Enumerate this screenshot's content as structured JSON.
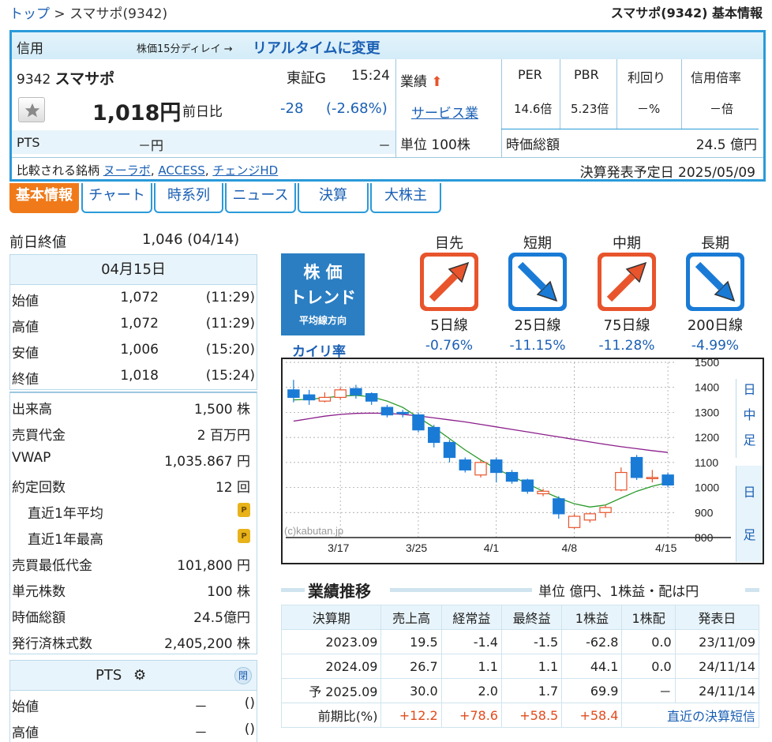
{
  "breadcrumb": {
    "top": "トップ",
    "sep": ">",
    "current": "スマサポ(9342)"
  },
  "page_title": "スマサポ(9342) 基本情報",
  "header": {
    "kind": "信用",
    "delay": "株価15分ディレイ →",
    "realtime": "リアルタイムに変更",
    "code": "9342",
    "name": "スマサポ",
    "market": "東証G",
    "time": "15:24",
    "price": "1,018円",
    "change_label": "前日比",
    "change": "-28",
    "change_pct": "(-2.68%)",
    "pts_label": "PTS",
    "pts_value": "－円",
    "pts_change": "－",
    "gyoseki": "業績",
    "industry": "サービス業",
    "unit": "単位 100株",
    "per_label": "PER",
    "per": "14.6倍",
    "pbr_label": "PBR",
    "pbr": "5.23倍",
    "yield_label": "利回り",
    "yield": "－%",
    "margin_label": "信用倍率",
    "margin": "－倍",
    "mcap_label": "時価総額",
    "mcap": "24.5 億円",
    "compare_label": "比較される銘柄",
    "compare": [
      "ヌーラボ",
      "ACCESS",
      "チェンジHD"
    ],
    "earnings_label": "決算発表予定日",
    "earnings_date": "2025/05/09"
  },
  "tabs": [
    "基本情報",
    "チャート",
    "時系列",
    "ニュース",
    "決算",
    "大株主"
  ],
  "prev_close": {
    "label": "前日終値",
    "value": "1,046 (04/14)"
  },
  "date_head": "04月15日",
  "ohlc": [
    {
      "k": "始値",
      "v": "1,072",
      "t": "(11:29)"
    },
    {
      "k": "高値",
      "v": "1,072",
      "t": "(11:29)"
    },
    {
      "k": "安値",
      "v": "1,006",
      "t": "(15:20)"
    },
    {
      "k": "終値",
      "v": "1,018",
      "t": "(15:24)"
    }
  ],
  "stats": [
    {
      "k": "出来高",
      "v": "1,500 株"
    },
    {
      "k": "売買代金",
      "v": "2 百万円"
    },
    {
      "k": "VWAP",
      "v": "1,035.867 円"
    },
    {
      "k": "約定回数",
      "v": "12 回"
    },
    {
      "k": "直近1年平均",
      "v": ""
    },
    {
      "k": "直近1年最高",
      "v": ""
    },
    {
      "k": "売買最低代金",
      "v": "101,800 円"
    },
    {
      "k": "単元株数",
      "v": "100 株"
    },
    {
      "k": "時価総額",
      "v": "24.5億円"
    },
    {
      "k": "発行済株式数",
      "v": "2,405,200 株"
    }
  ],
  "pts": {
    "title": "PTS",
    "close_btn": "閉",
    "rows": [
      {
        "k": "始値",
        "v": "－",
        "t": "()"
      },
      {
        "k": "高値",
        "v": "－",
        "t": "()"
      }
    ]
  },
  "trend": {
    "box": [
      "株 価",
      "トレンド",
      "平均線方向"
    ],
    "kairi": "カイリ率",
    "items": [
      {
        "term": "目先",
        "line": "5日線",
        "rate": "-0.76%",
        "dir": "up"
      },
      {
        "term": "短期",
        "line": "25日線",
        "rate": "-11.15%",
        "dir": "down"
      },
      {
        "term": "中期",
        "line": "75日線",
        "rate": "-11.28%",
        "dir": "up"
      },
      {
        "term": "長期",
        "line": "200日線",
        "rate": "-4.99%",
        "dir": "down"
      }
    ]
  },
  "period_side": {
    "chars1": [
      "日",
      "中",
      "足"
    ],
    "chars2": [
      "日",
      "足"
    ]
  },
  "chart_data": {
    "type": "candlestick",
    "watermark": "(c)kabutan.jp",
    "x_ticks": [
      "3/17",
      "3/25",
      "4/1",
      "4/8",
      "4/15"
    ],
    "y_ticks": [
      1500,
      1400,
      1300,
      1200,
      1100,
      1000,
      900,
      800
    ],
    "ylim": [
      800,
      1500
    ],
    "candles": [
      {
        "o": 1390,
        "c": 1360,
        "h": 1430,
        "l": 1340
      },
      {
        "o": 1370,
        "c": 1350,
        "h": 1390,
        "l": 1330
      },
      {
        "o": 1345,
        "c": 1360,
        "h": 1380,
        "l": 1340
      },
      {
        "o": 1360,
        "c": 1390,
        "h": 1400,
        "l": 1350
      },
      {
        "o": 1395,
        "c": 1370,
        "h": 1410,
        "l": 1355
      },
      {
        "o": 1375,
        "c": 1345,
        "h": 1380,
        "l": 1330
      },
      {
        "o": 1320,
        "c": 1290,
        "h": 1330,
        "l": 1280
      },
      {
        "o": 1300,
        "c": 1295,
        "h": 1310,
        "l": 1280
      },
      {
        "o": 1290,
        "c": 1230,
        "h": 1300,
        "l": 1220
      },
      {
        "o": 1240,
        "c": 1180,
        "h": 1250,
        "l": 1160
      },
      {
        "o": 1180,
        "c": 1120,
        "h": 1190,
        "l": 1100
      },
      {
        "o": 1110,
        "c": 1070,
        "h": 1120,
        "l": 1060
      },
      {
        "o": 1050,
        "c": 1100,
        "h": 1110,
        "l": 1040
      },
      {
        "o": 1110,
        "c": 1060,
        "h": 1120,
        "l": 1020
      },
      {
        "o": 1060,
        "c": 1025,
        "h": 1070,
        "l": 1015
      },
      {
        "o": 1030,
        "c": 985,
        "h": 1035,
        "l": 975
      },
      {
        "o": 975,
        "c": 985,
        "h": 995,
        "l": 965
      },
      {
        "o": 955,
        "c": 895,
        "h": 965,
        "l": 875
      },
      {
        "o": 840,
        "c": 885,
        "h": 895,
        "l": 835
      },
      {
        "o": 870,
        "c": 895,
        "h": 900,
        "l": 860
      },
      {
        "o": 900,
        "c": 920,
        "h": 930,
        "l": 880
      },
      {
        "o": 990,
        "c": 1060,
        "h": 1080,
        "l": 985
      },
      {
        "o": 1120,
        "c": 1040,
        "h": 1130,
        "l": 1030
      },
      {
        "o": 1040,
        "c": 1040,
        "h": 1070,
        "l": 1020
      },
      {
        "o": 1050,
        "c": 1010,
        "h": 1060,
        "l": 1000
      }
    ],
    "ma_short": [
      1350,
      1352,
      1358,
      1365,
      1368,
      1362,
      1345,
      1320,
      1280,
      1240,
      1195,
      1150,
      1110,
      1075,
      1045,
      1015,
      985,
      958,
      935,
      922,
      930,
      958,
      985,
      1005,
      1020
    ],
    "ma_long": [
      1265,
      1275,
      1285,
      1292,
      1296,
      1297,
      1296,
      1292,
      1286,
      1278,
      1270,
      1262,
      1252,
      1242,
      1232,
      1222,
      1212,
      1202,
      1192,
      1182,
      1172,
      1163,
      1155,
      1147,
      1140
    ]
  },
  "results": {
    "title": "業績推移",
    "unit": "単位 億円、1株益・配は円",
    "headers": [
      "決算期",
      "売上高",
      "経常益",
      "最終益",
      "1株益",
      "1株配",
      "発表日"
    ],
    "rows": [
      [
        "2023.09",
        "19.5",
        "-1.4",
        "-1.5",
        "-62.8",
        "0.0",
        "23/11/09"
      ],
      [
        "2024.09",
        "26.7",
        "1.1",
        "1.1",
        "44.1",
        "0.0",
        "24/11/14"
      ],
      [
        "予 2025.09",
        "30.0",
        "2.0",
        "1.7",
        "69.9",
        "－",
        "24/11/14"
      ]
    ],
    "ratio": [
      "前期比(%)",
      "+12.2",
      "+78.6",
      "+58.5",
      "+58.4"
    ],
    "latest_link": "直近の決算短信"
  }
}
